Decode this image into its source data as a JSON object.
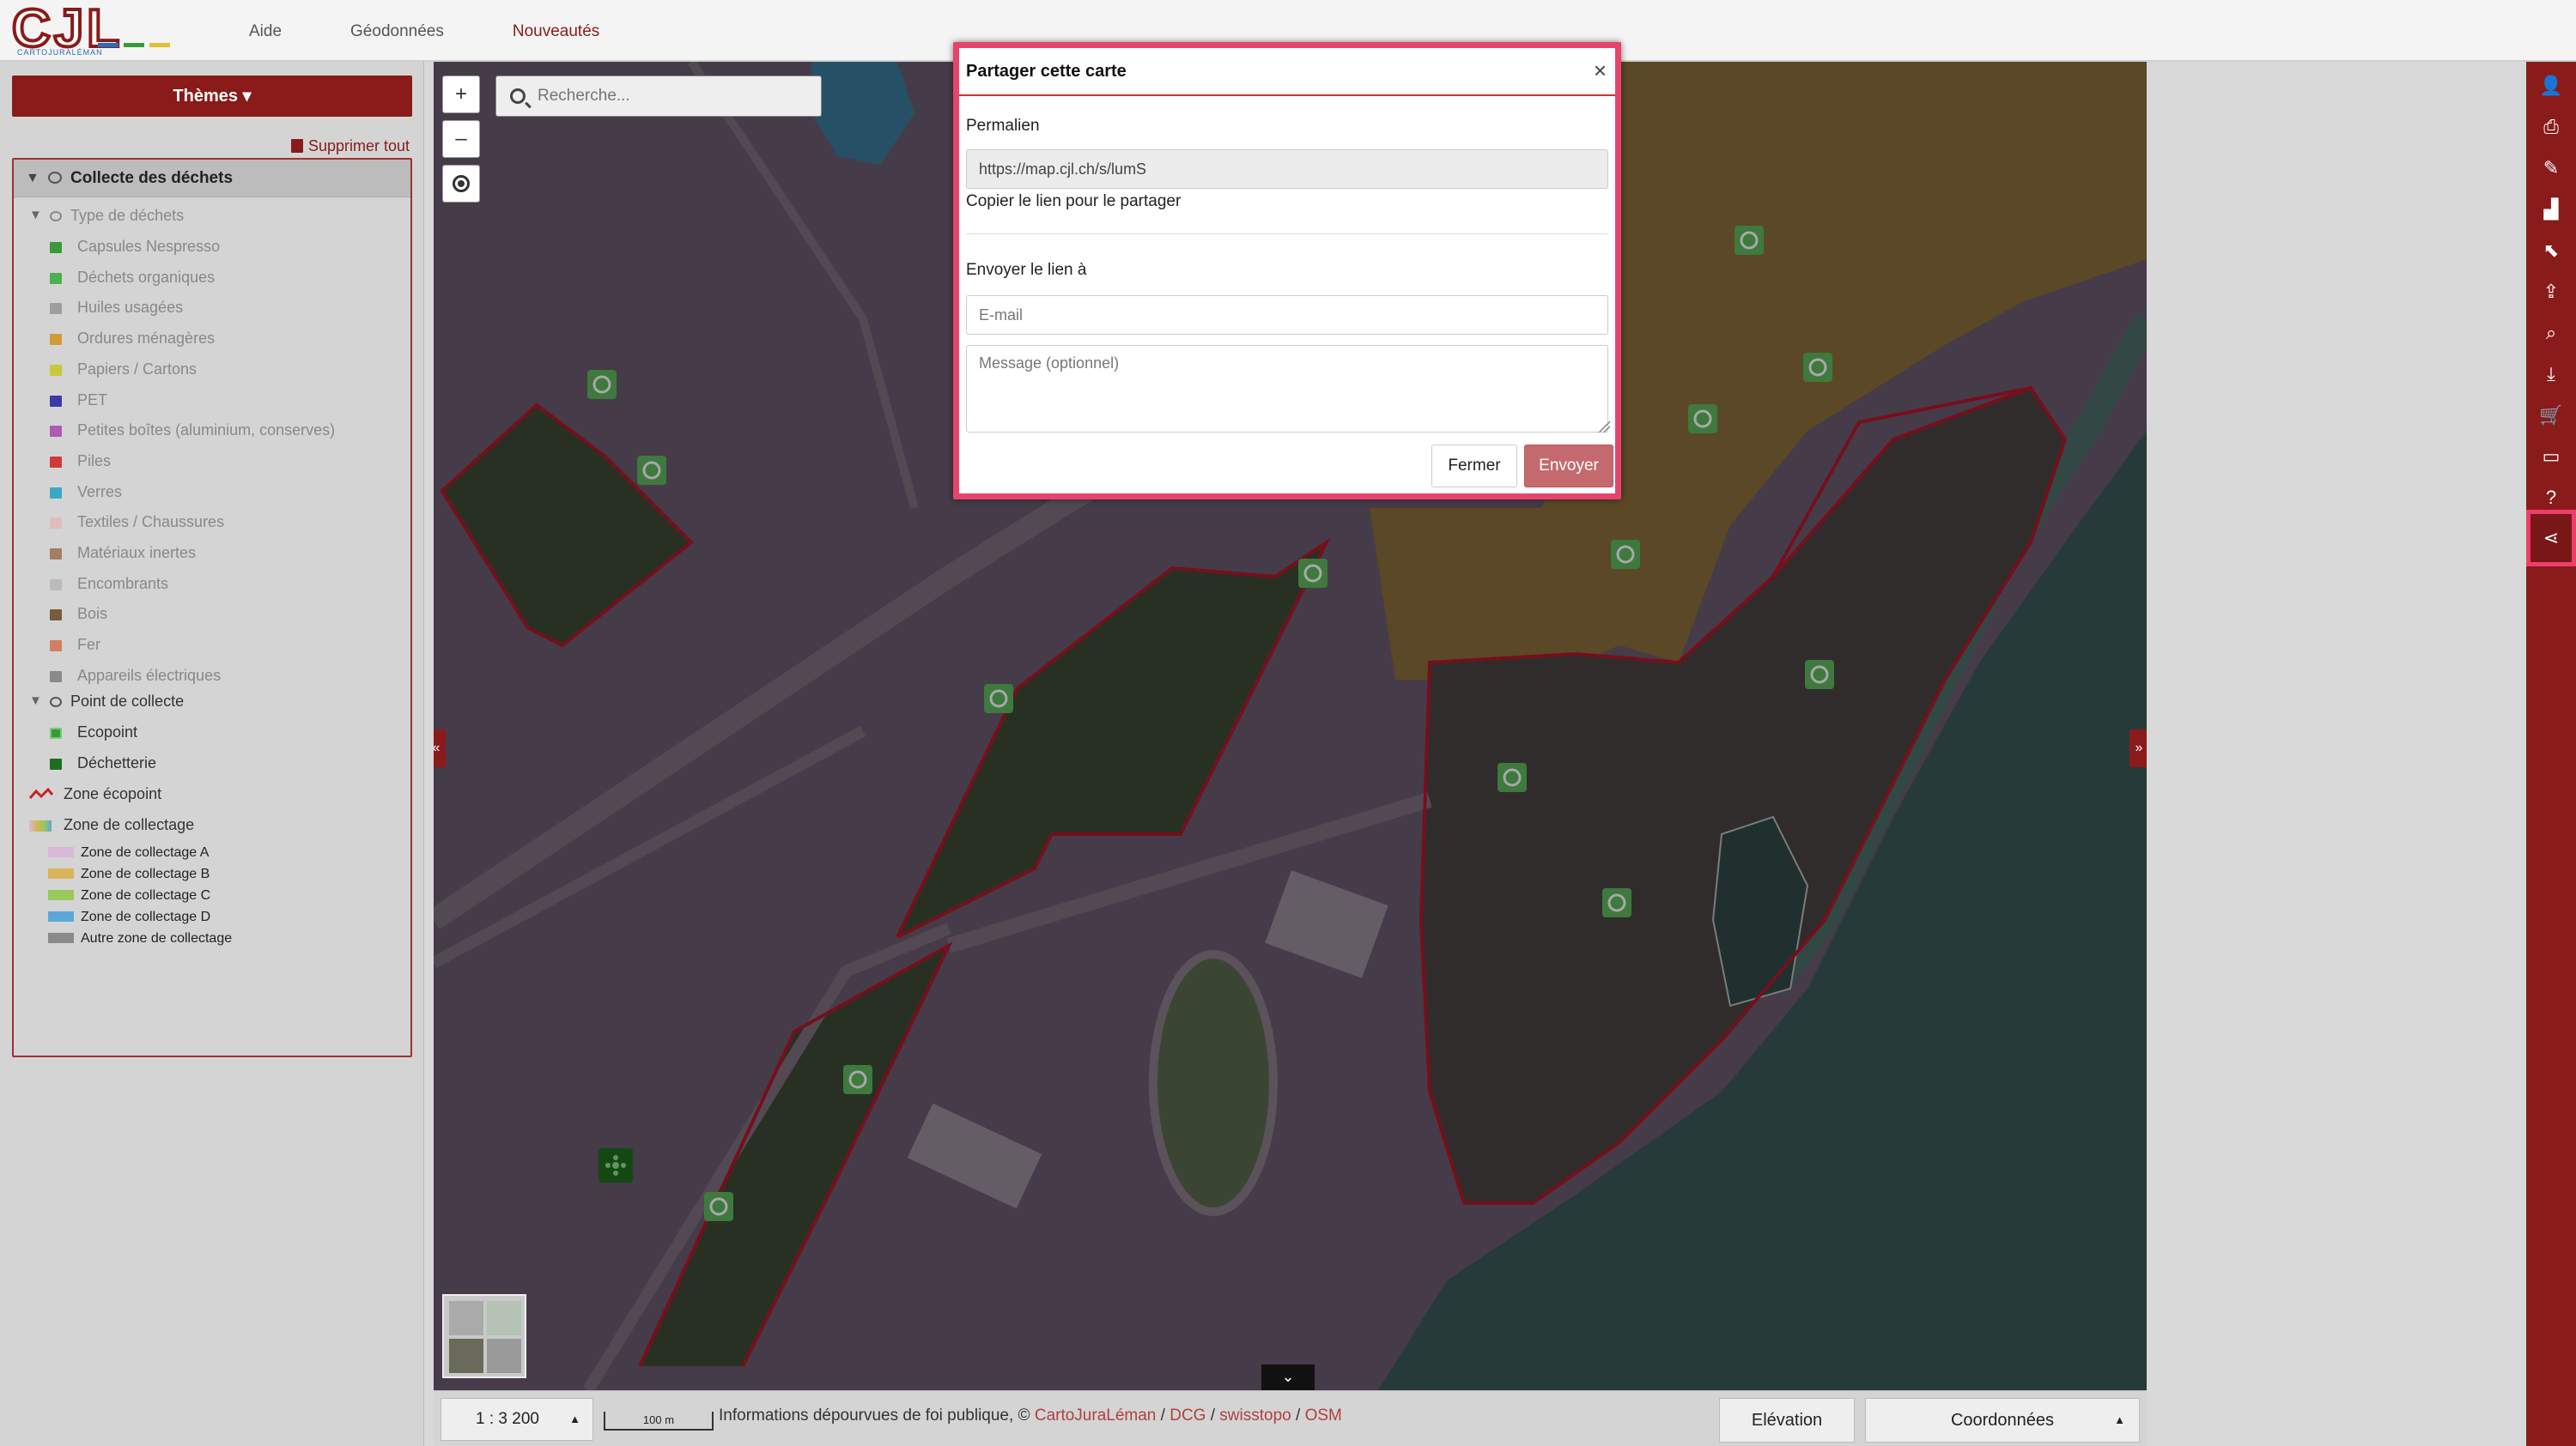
{
  "topbar": {
    "logo_text": "CJL",
    "logo_tag": "CARTOJURALÉMAN",
    "nav": [
      {
        "label": "Aide"
      },
      {
        "label": "Géodonnées"
      },
      {
        "label": "Nouveautés"
      }
    ]
  },
  "sidebar": {
    "themes_label": "Thèmes ▾",
    "delete_all_label": "Supprimer tout",
    "group_title": "Collecte des déchets",
    "waste_type_label": "Type de déchets",
    "waste_types": [
      {
        "label": "Capsules Nespresso",
        "color": "#3a9a3a"
      },
      {
        "label": "Déchets organiques",
        "color": "#4caf50"
      },
      {
        "label": "Huiles usagées",
        "color": "#9e9e9e"
      },
      {
        "label": "Ordures ménagères",
        "color": "#d49a3a"
      },
      {
        "label": "Papiers / Cartons",
        "color": "#c8c83a"
      },
      {
        "label": "PET",
        "color": "#3a3aa8"
      },
      {
        "label": "Petites boîtes (aluminium, conserves)",
        "color": "#b05ab0"
      },
      {
        "label": "Piles",
        "color": "#d23a3a"
      },
      {
        "label": "Verres",
        "color": "#3aa8c8"
      },
      {
        "label": "Textiles / Chaussures",
        "color": "#e0bcbc"
      },
      {
        "label": "Matériaux inertes",
        "color": "#a08060"
      },
      {
        "label": "Encombrants",
        "color": "#bbbbbb"
      },
      {
        "label": "Bois",
        "color": "#7a5a3a"
      },
      {
        "label": "Fer",
        "color": "#d08060"
      },
      {
        "label": "Appareils électriques",
        "color": "#8a8a8a"
      }
    ],
    "collect_point_label": "Point de collecte",
    "collect_points": [
      {
        "label": "Ecopoint"
      },
      {
        "label": "Déchetterie"
      }
    ],
    "zone_ecopoint_label": "Zone écopoint",
    "zone_collectage_label": "Zone de collectage",
    "zones": [
      {
        "label": "Zone de collectage A",
        "color": "#d9b8d9"
      },
      {
        "label": "Zone de collectage B",
        "color": "#d9b45a"
      },
      {
        "label": "Zone de collectage C",
        "color": "#9ac85a"
      },
      {
        "label": "Zone de collectage D",
        "color": "#5aa8d9"
      },
      {
        "label": "Autre zone de collectage",
        "color": "#8a8a8a"
      }
    ]
  },
  "map": {
    "search_placeholder": "Recherche...",
    "zoom_in": "+",
    "zoom_out": "–"
  },
  "bottombar": {
    "scale": "1 : 3 200",
    "scalebar": "100 m",
    "attribution_text": "Informations dépourvues de foi publique, © ",
    "attrib_links": [
      "CartoJuraLéman",
      "DCG",
      "swisstopo",
      "OSM"
    ],
    "elevation_label": "Elévation",
    "coords_label": "Coordonnées"
  },
  "modal": {
    "title": "Partager cette carte",
    "permalink_label": "Permalien",
    "permalink_value": "https://map.cjl.ch/s/lumS",
    "copy_hint": "Copier le lien pour le partager",
    "send_label": "Envoyer le lien à",
    "email_placeholder": "E-mail",
    "message_placeholder": "Message (optionnel)",
    "close_label": "Fermer",
    "send_button": "Envoyer"
  }
}
